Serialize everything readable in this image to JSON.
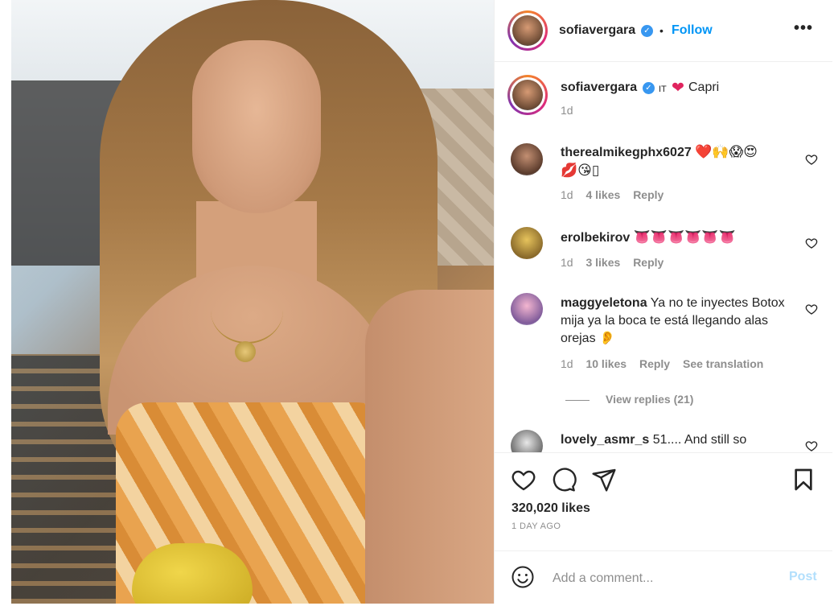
{
  "post": {
    "username": "sofiavergara",
    "follow_label": "Follow",
    "more_label": "•••",
    "dot": "•",
    "caption_flag": "IT",
    "caption_text": "Capri",
    "caption_time": "1d"
  },
  "comments": [
    {
      "username": "therealmikegphx6027",
      "text_line1": "❤️🙌😱😍",
      "text_line2": "💋😘▯",
      "time": "1d",
      "likes": "4 likes",
      "reply": "Reply"
    },
    {
      "username": "erolbekirov",
      "text": "👅👅👅👅👅👅",
      "time": "1d",
      "likes": "3 likes",
      "reply": "Reply"
    },
    {
      "username": "maggyeletona",
      "text": "Ya no te inyectes Botox mija ya la boca te está llegando alas orejas 👂",
      "time": "1d",
      "likes": "10 likes",
      "reply": "Reply",
      "translate": "See translation"
    },
    {
      "username": "lovely_asmr_s",
      "text": "51.... And still so"
    }
  ],
  "view_replies": "View replies (21)",
  "likes_count": "320,020 likes",
  "posted_ago": "1 DAY AGO",
  "add_comment": {
    "placeholder": "Add a comment...",
    "post_label": "Post"
  },
  "colors": {
    "follow": "#0095f6",
    "verified": "#3897f0",
    "post_disabled": "#b2dffc"
  }
}
